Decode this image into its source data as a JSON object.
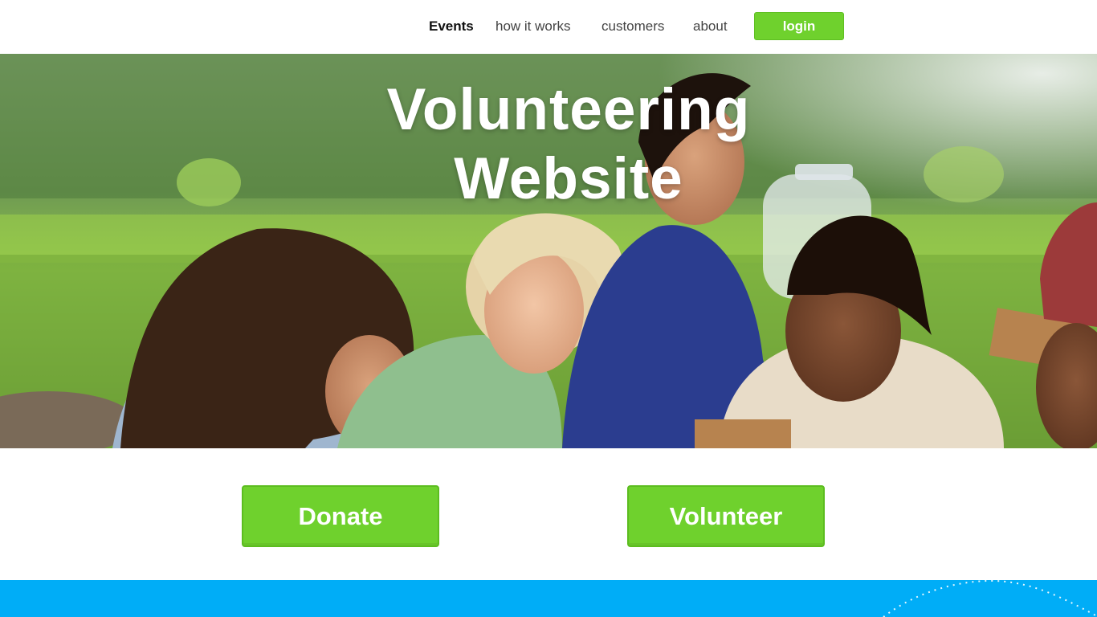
{
  "nav": {
    "items": [
      {
        "label": "Events",
        "active": true
      },
      {
        "label": "how it works",
        "active": false
      },
      {
        "label": "customers",
        "active": false
      },
      {
        "label": "about",
        "active": false
      }
    ],
    "login_label": "login"
  },
  "hero": {
    "title_line1": "Volunteering",
    "title_line2": "Website",
    "image": "photo of smiling volunteers outdoors in a green field"
  },
  "cta": {
    "donate_label": "Donate",
    "volunteer_label": "Volunteer"
  },
  "colors": {
    "accent_green": "#6fd12d",
    "footer_blue": "#00adf7",
    "nav_text": "#444444",
    "nav_active_text": "#111111"
  }
}
